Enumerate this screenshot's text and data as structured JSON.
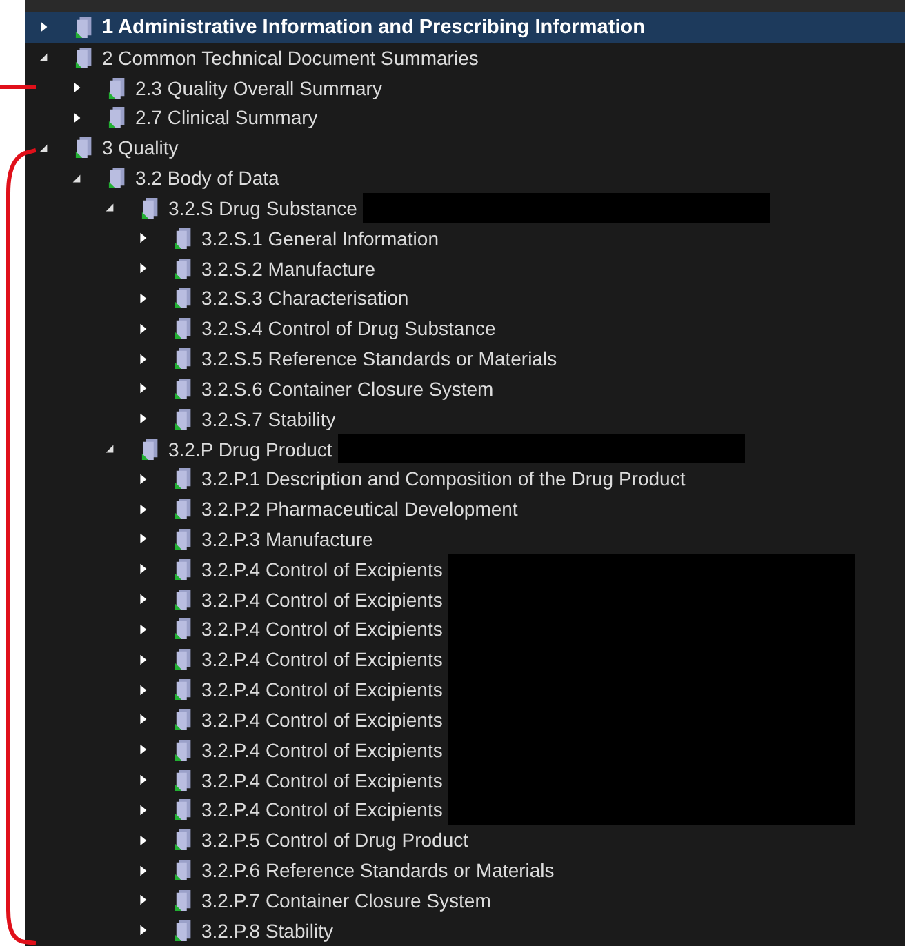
{
  "tree": [
    {
      "label": "1 Administrative Information and Prescribing Information",
      "selected": true,
      "expanded": false,
      "redacted": false
    },
    {
      "label": "2 Common Technical Document Summaries",
      "selected": false,
      "expanded": true,
      "redacted": false,
      "children": [
        {
          "label": "2.3 Quality Overall Summary",
          "selected": false,
          "expanded": false,
          "redacted": false
        },
        {
          "label": "2.7 Clinical Summary",
          "selected": false,
          "expanded": false,
          "redacted": false
        }
      ]
    },
    {
      "label": "3 Quality",
      "selected": false,
      "expanded": true,
      "redacted": false,
      "children": [
        {
          "label": "3.2 Body of Data",
          "selected": false,
          "expanded": true,
          "redacted": false,
          "children": [
            {
              "label": "3.2.S Drug Substance",
              "selected": false,
              "expanded": true,
              "redacted": true,
              "children": [
                {
                  "label": "3.2.S.1 General Information",
                  "selected": false,
                  "expanded": false,
                  "redacted": false
                },
                {
                  "label": "3.2.S.2 Manufacture",
                  "selected": false,
                  "expanded": false,
                  "redacted": false
                },
                {
                  "label": "3.2.S.3 Characterisation",
                  "selected": false,
                  "expanded": false,
                  "redacted": false
                },
                {
                  "label": "3.2.S.4 Control of Drug Substance",
                  "selected": false,
                  "expanded": false,
                  "redacted": false
                },
                {
                  "label": "3.2.S.5 Reference Standards or Materials",
                  "selected": false,
                  "expanded": false,
                  "redacted": false
                },
                {
                  "label": "3.2.S.6 Container Closure System",
                  "selected": false,
                  "expanded": false,
                  "redacted": false
                },
                {
                  "label": "3.2.S.7 Stability",
                  "selected": false,
                  "expanded": false,
                  "redacted": false
                }
              ]
            },
            {
              "label": "3.2.P Drug Product",
              "selected": false,
              "expanded": true,
              "redacted": true,
              "children": [
                {
                  "label": "3.2.P.1 Description and Composition of the Drug Product",
                  "selected": false,
                  "expanded": false,
                  "redacted": false
                },
                {
                  "label": "3.2.P.2 Pharmaceutical Development",
                  "selected": false,
                  "expanded": false,
                  "redacted": false
                },
                {
                  "label": "3.2.P.3 Manufacture",
                  "selected": false,
                  "expanded": false,
                  "redacted": false
                },
                {
                  "label": "3.2.P.4 Control of Excipients",
                  "selected": false,
                  "expanded": false,
                  "redacted": true
                },
                {
                  "label": "3.2.P.4 Control of Excipients",
                  "selected": false,
                  "expanded": false,
                  "redacted": true
                },
                {
                  "label": "3.2.P.4 Control of Excipients",
                  "selected": false,
                  "expanded": false,
                  "redacted": true
                },
                {
                  "label": "3.2.P.4 Control of Excipients",
                  "selected": false,
                  "expanded": false,
                  "redacted": true
                },
                {
                  "label": "3.2.P.4 Control of Excipients",
                  "selected": false,
                  "expanded": false,
                  "redacted": true
                },
                {
                  "label": "3.2.P.4 Control of Excipients",
                  "selected": false,
                  "expanded": false,
                  "redacted": true
                },
                {
                  "label": "3.2.P.4 Control of Excipients",
                  "selected": false,
                  "expanded": false,
                  "redacted": true
                },
                {
                  "label": "3.2.P.4 Control of Excipients",
                  "selected": false,
                  "expanded": false,
                  "redacted": true
                },
                {
                  "label": "3.2.P.4 Control of Excipients",
                  "selected": false,
                  "expanded": false,
                  "redacted": true
                },
                {
                  "label": "3.2.P.5 Control of Drug Product",
                  "selected": false,
                  "expanded": false,
                  "redacted": false
                },
                {
                  "label": "3.2.P.6 Reference Standards or Materials",
                  "selected": false,
                  "expanded": false,
                  "redacted": false
                },
                {
                  "label": "3.2.P.7 Container Closure System",
                  "selected": false,
                  "expanded": false,
                  "redacted": false
                },
                {
                  "label": "3.2.P.8 Stability",
                  "selected": false,
                  "expanded": false,
                  "redacted": false
                }
              ]
            }
          ]
        }
      ]
    }
  ]
}
